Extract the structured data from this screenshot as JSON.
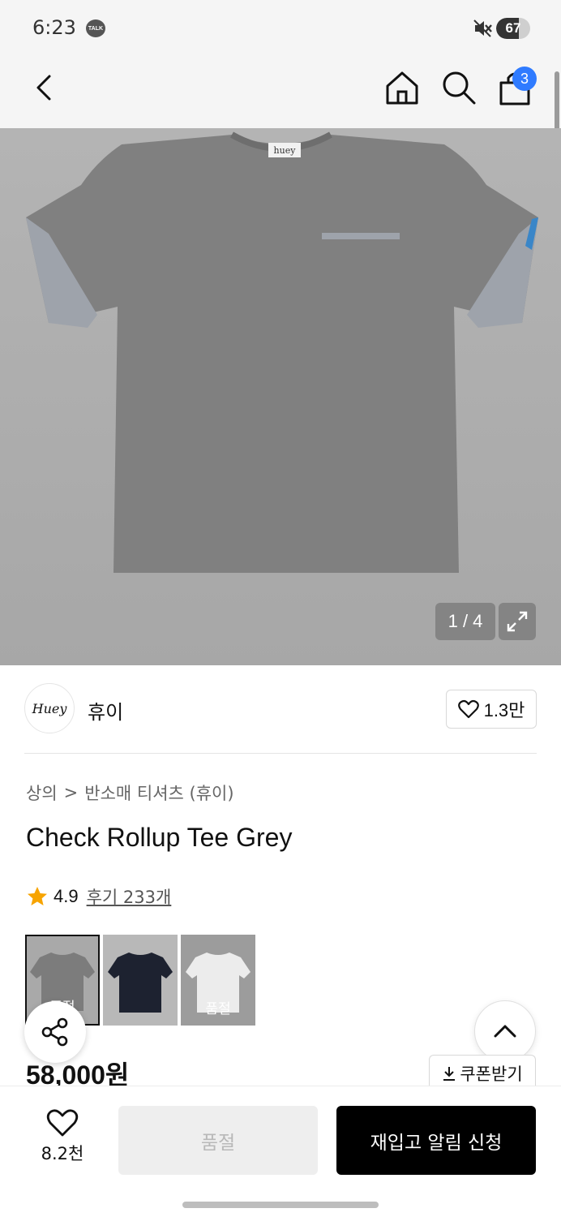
{
  "status_bar": {
    "time": "6:23",
    "talk_badge": "TALK",
    "battery_level": "67",
    "battery_fraction": 0.67,
    "icons": [
      "talk-icon",
      "mute-icon",
      "battery-icon"
    ]
  },
  "header": {
    "icons": [
      "back-arrow-icon",
      "home-icon",
      "search-icon",
      "cart-icon"
    ],
    "cart_count": "3"
  },
  "gallery": {
    "pager": "1 / 4",
    "garment_tag": "huey",
    "colors": {
      "background": "#b0b0b0",
      "shirt": "#808080"
    }
  },
  "brand": {
    "logo_text": "Huey",
    "name": "휴이",
    "likes": "1.3만"
  },
  "breadcrumb": {
    "category": "상의",
    "separator": ">",
    "subcategory": "반소매 티셔츠 (휴이)"
  },
  "product": {
    "title": "Check Rollup Tee Grey",
    "rating": "4.9",
    "reviews": "후기 233개",
    "price": "58,000원"
  },
  "swatches": [
    {
      "name": "grey",
      "color": "#7c7c7c",
      "sold_label": "품절",
      "selected": true
    },
    {
      "name": "navy",
      "color": "#1d2230",
      "sold_label": "",
      "selected": false
    },
    {
      "name": "white",
      "color": "#ececec",
      "sold_label": "품절",
      "selected": false
    }
  ],
  "coupon": {
    "label": "쿠폰받기"
  },
  "bottom_bar": {
    "wish_count": "8.2천",
    "soldout_label": "품절",
    "restock_label": "재입고 알림 신청"
  },
  "colors": {
    "accent": "#2f7bff",
    "star": "#f7a400",
    "primary_button": "#000000",
    "disabled_button": "#eeeeee"
  }
}
